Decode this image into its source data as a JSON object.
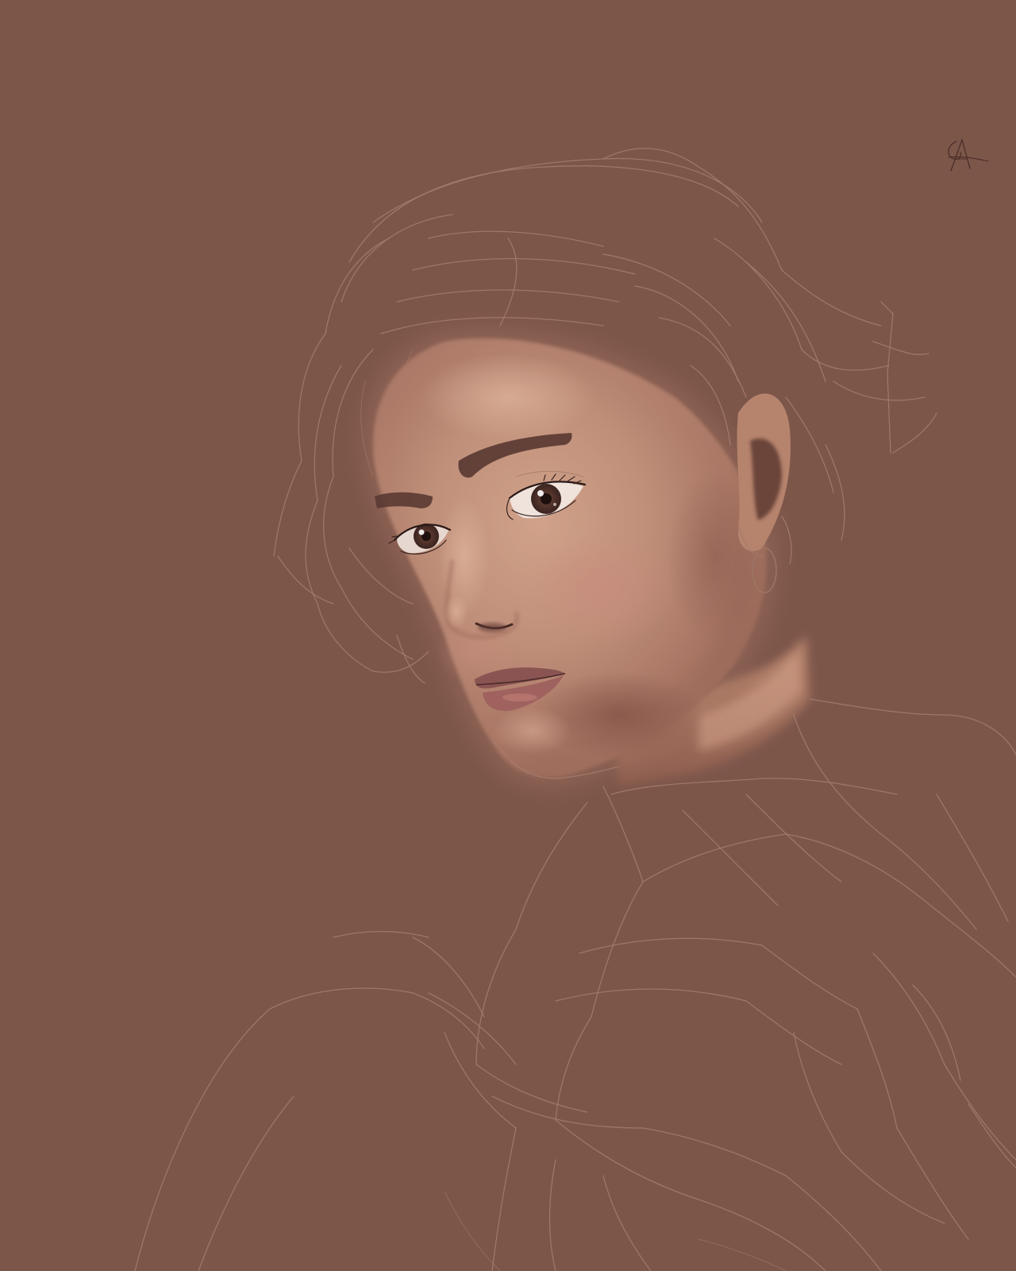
{
  "artwork": {
    "subject": "",
    "colors": {
      "background": "#7d564a",
      "skin_light": "#c99982",
      "skin_mid": "#b07f6d",
      "skin_shadow": "#8f5f50",
      "lips": "#8a5452",
      "brow": "#5a3a33",
      "iris": "#4a2e28",
      "sketch_line": "#a57d6d"
    },
    "signature_icon": "monogram-signature-icon"
  }
}
